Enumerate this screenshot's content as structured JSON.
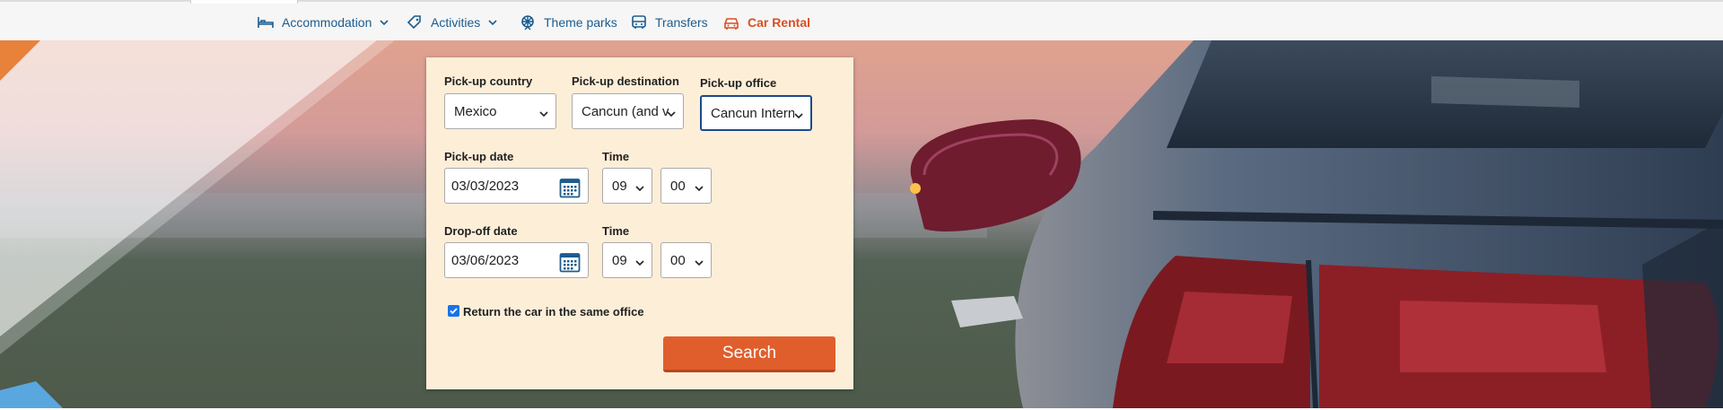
{
  "nav": {
    "items": [
      {
        "label": "Accommodation",
        "icon": "bed-icon",
        "has_dropdown": true
      },
      {
        "label": "Activities",
        "icon": "tag-icon",
        "has_dropdown": true
      },
      {
        "label": "Theme parks",
        "icon": "ferris-wheel-icon",
        "has_dropdown": false
      },
      {
        "label": "Transfers",
        "icon": "bus-icon",
        "has_dropdown": false
      },
      {
        "label": "Car Rental",
        "icon": "car-icon",
        "has_dropdown": false,
        "active": true
      }
    ]
  },
  "colors": {
    "nav_link": "#1c5c8e",
    "active": "#d94f22",
    "panel_bg": "#fdeed8",
    "button": "#e05e2c",
    "focus_border": "#1c4a8e"
  },
  "form": {
    "pickup_country": {
      "label": "Pick-up country",
      "value": "Mexico"
    },
    "pickup_destination": {
      "label": "Pick-up destination",
      "value": "Cancun (and v"
    },
    "pickup_office": {
      "label": "Pick-up office",
      "value": "Cancun Intern"
    },
    "pickup_date": {
      "label": "Pick-up date",
      "value": "03/03/2023"
    },
    "pickup_time": {
      "label": "Time",
      "hour": "09",
      "minute": "00"
    },
    "dropoff_date": {
      "label": "Drop-off date",
      "value": "03/06/2023"
    },
    "dropoff_time": {
      "label": "Time",
      "hour": "09",
      "minute": "00"
    },
    "same_office": {
      "label": "Return the car in the same office",
      "checked": true
    },
    "search_label": "Search"
  }
}
